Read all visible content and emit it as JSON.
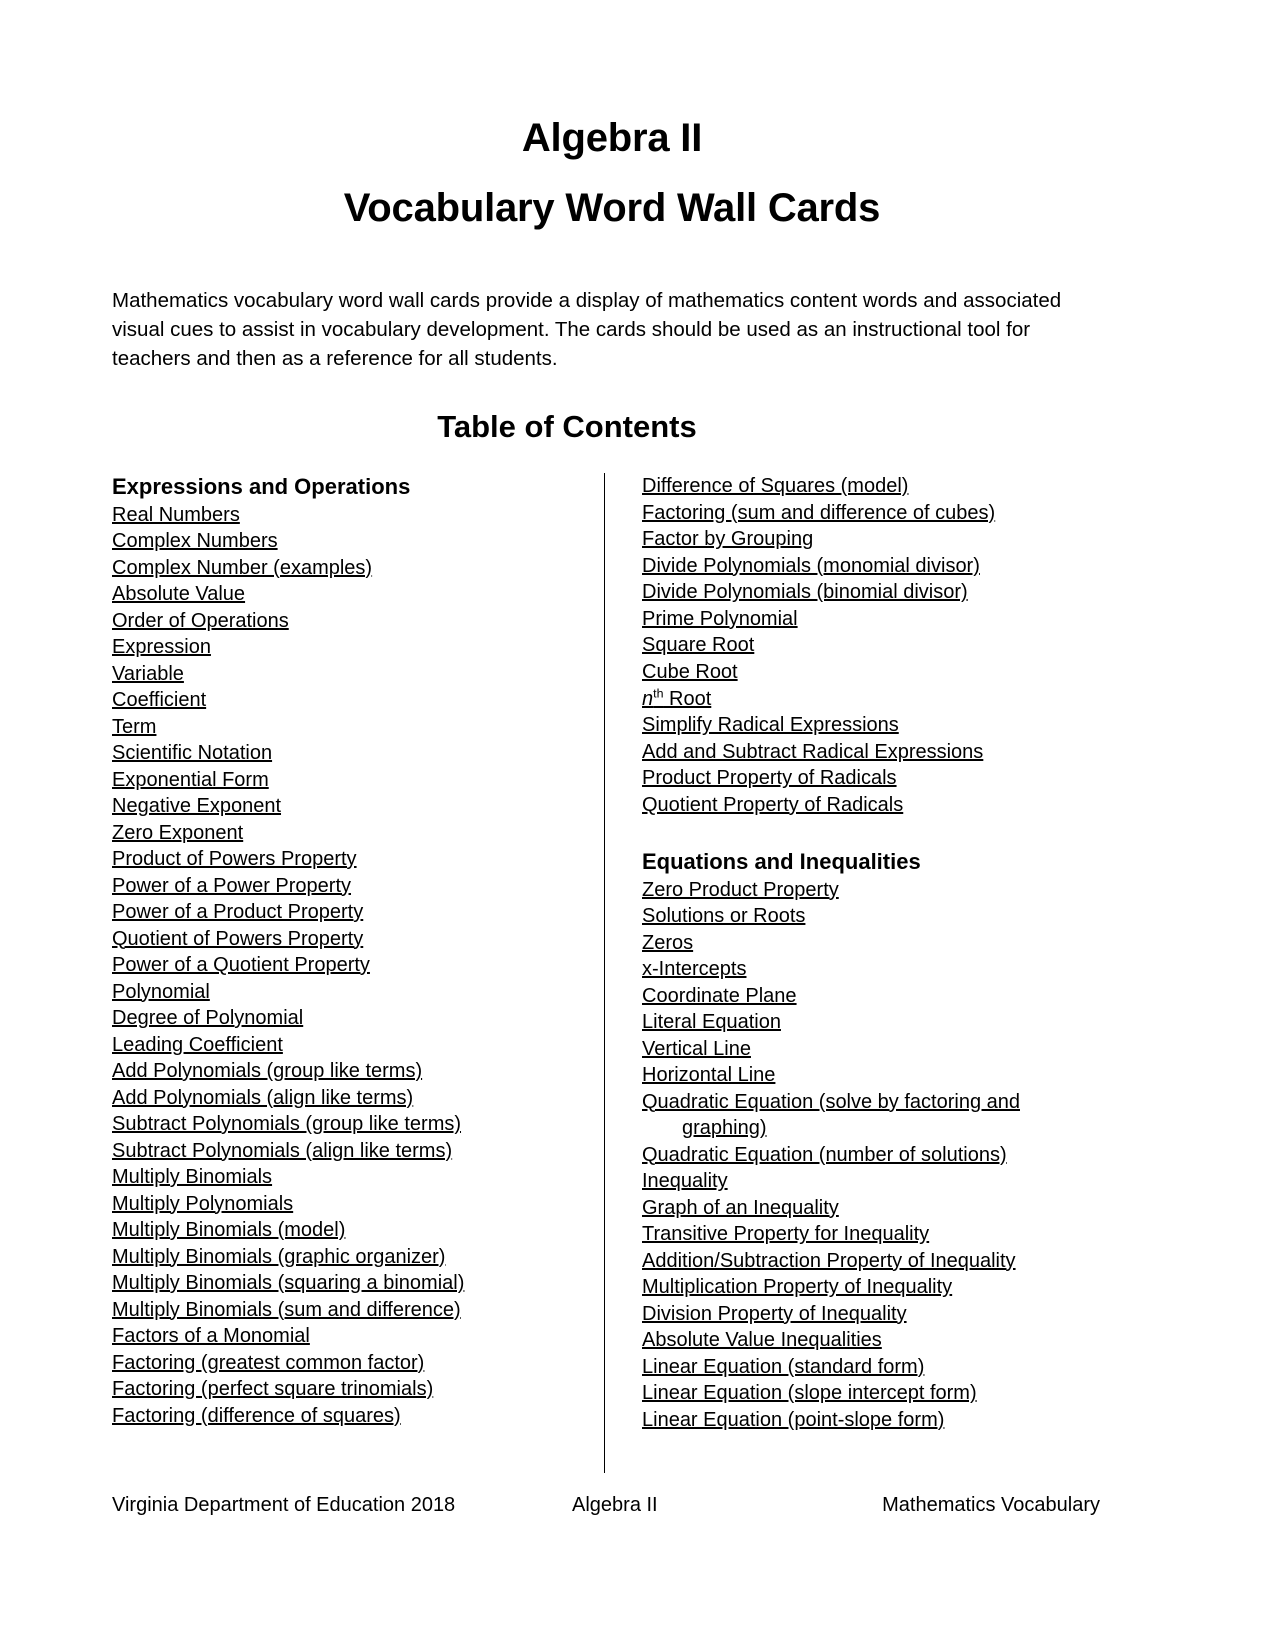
{
  "document": {
    "title_line1": "Algebra II",
    "title_line2": "Vocabulary Word Wall Cards",
    "intro": "Mathematics vocabulary word wall cards provide a display of mathematics content words and associated visual cues to assist in vocabulary development. The cards should be used as an instructional tool for teachers and then as a reference for all students.",
    "toc_heading": "Table of Contents"
  },
  "sections": {
    "expressions_and_operations": {
      "heading": "Expressions and Operations",
      "items": [
        "Real Numbers",
        "Complex Numbers",
        "Complex Number (examples)",
        "Absolute Value",
        "Order of Operations",
        "Expression",
        "Variable",
        "Coefficient",
        "Term",
        "Scientific Notation",
        "Exponential Form",
        "Negative Exponent",
        "Zero Exponent",
        "Product of Powers Property",
        "Power of a Power Property",
        "Power of a Product Property",
        "Quotient of Powers Property",
        "Power of a Quotient Property",
        "Polynomial",
        "Degree of Polynomial",
        "Leading Coefficient",
        "Add Polynomials (group like terms)",
        "Add Polynomials (align like terms)",
        "Subtract Polynomials (group like terms)",
        "Subtract Polynomials (align like terms)",
        "Multiply Binomials",
        "Multiply Polynomials",
        "Multiply Binomials (model)",
        "Multiply Binomials (graphic organizer)",
        "Multiply Binomials (squaring a binomial)",
        "Multiply Binomials (sum and difference)",
        "Factors of a Monomial",
        "Factoring (greatest common factor)",
        "Factoring (perfect square trinomials)",
        "Factoring (difference of squares)"
      ],
      "items_continued": [
        "Difference of Squares (model)",
        "Factoring (sum and difference of cubes)",
        "Factor by Grouping",
        "Divide Polynomials (monomial divisor)",
        "Divide Polynomials (binomial divisor)",
        "Prime Polynomial",
        "Square Root",
        "Cube Root",
        "nth Root",
        "Simplify Radical Expressions",
        "Add and Subtract Radical Expressions",
        "Product Property of Radicals",
        "Quotient Property of Radicals"
      ]
    },
    "equations_and_inequalities": {
      "heading": "Equations and Inequalities",
      "items": [
        "Zero Product Property",
        "Solutions or Roots",
        "Zeros",
        "x-Intercepts",
        "Coordinate Plane",
        "Literal Equation",
        "Vertical Line",
        "Horizontal Line",
        "Quadratic Equation (solve by factoring and graphing)",
        "Quadratic Equation (number of solutions)",
        "Inequality",
        "Graph of an Inequality",
        "Transitive Property for Inequality",
        "Addition/Subtraction Property of Inequality",
        "Multiplication Property of Inequality",
        "Division Property of Inequality",
        "Absolute Value Inequalities",
        "Linear Equation (standard form)",
        "Linear Equation (slope intercept form)",
        "Linear Equation (point-slope form)"
      ]
    }
  },
  "wrapped_items": {
    "quadratic_line1": "Quadratic Equation (solve by factoring and",
    "quadratic_line2": "graphing)"
  },
  "nth_root": {
    "n": "n",
    "sup": "th",
    "rest": " Root"
  },
  "footer": {
    "left": "Virginia Department of Education 2018",
    "center": "Algebra II",
    "right": "Mathematics Vocabulary"
  }
}
